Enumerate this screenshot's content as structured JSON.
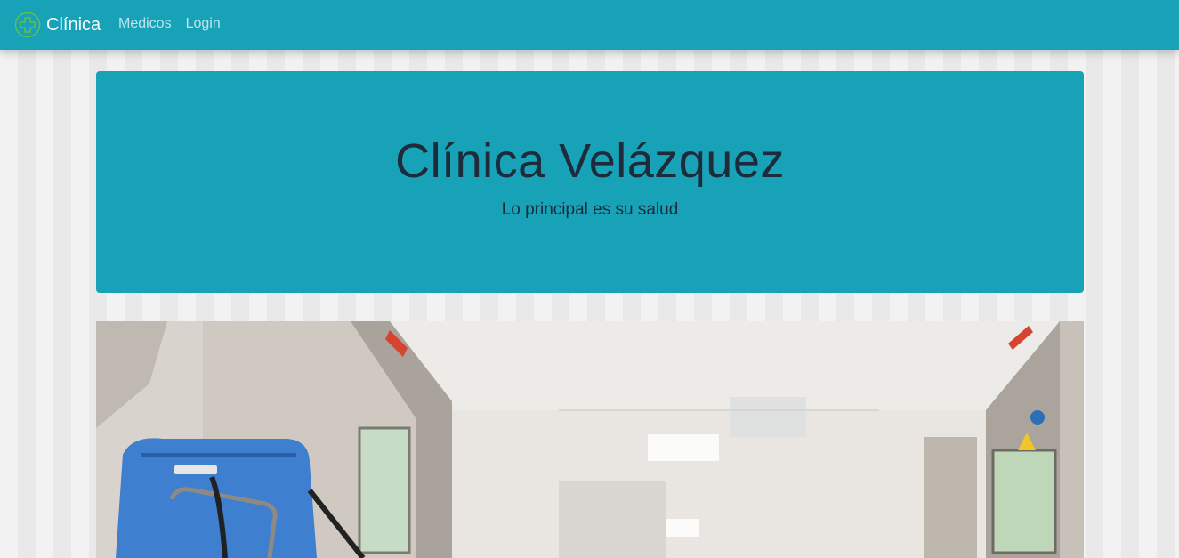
{
  "navbar": {
    "brand": "Clínica",
    "brand_icon": "medical-cross-icon",
    "links": [
      {
        "label": "Medicos"
      },
      {
        "label": "Login"
      }
    ],
    "color": "#18a2b8"
  },
  "hero": {
    "title": "Clínica Velázquez",
    "subtitle": "Lo principal es su salud",
    "color": "#18a2b8"
  },
  "image": {
    "subject": "hospital-corridor-photo"
  }
}
